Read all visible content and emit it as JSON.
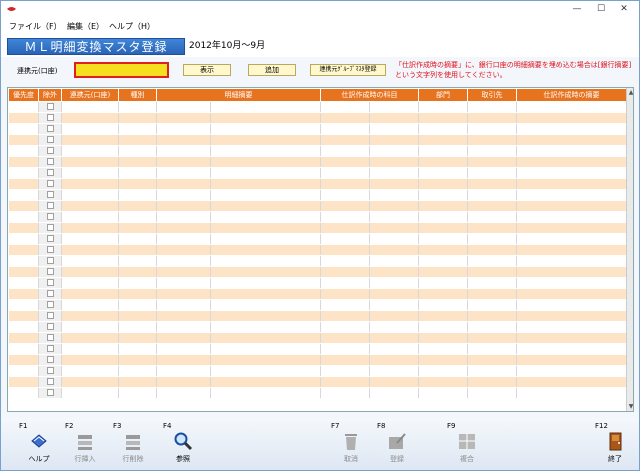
{
  "window": {
    "controls": {
      "minimize": "—",
      "maximize": "☐",
      "close": "✕"
    }
  },
  "menu": {
    "file": "ファイル（F）",
    "edit": "編集（E）",
    "help": "ヘルプ（H）"
  },
  "header": {
    "title": "ＭＬ明細変換マスタ登録",
    "period": "2012年10月～9月"
  },
  "controls": {
    "account_label": "連携元(口座)",
    "account_value": "",
    "show_button": "表示",
    "add_button": "追加",
    "group_button": "連携元ｸﾞﾙｰﾌﾟﾏｽﾀ登録",
    "notice": "「仕訳作成時の摘要」に、銀行口座の明細摘要を埋め込む場合は[銀行摘要]という文字列を使用してください。"
  },
  "grid": {
    "columns": [
      "優先度",
      "除外",
      "連携元(口座)",
      "種別",
      "明細摘要",
      "仕訳作成時の科目",
      "部門",
      "取引先",
      "仕訳作成時の摘要"
    ],
    "row_count": 27
  },
  "fkeys": [
    {
      "key": "F1",
      "label": "ヘルプ",
      "icon": "help-book-icon",
      "enabled": true
    },
    {
      "key": "F2",
      "label": "行挿入",
      "icon": "insert-row-icon",
      "enabled": false
    },
    {
      "key": "F3",
      "label": "行削除",
      "icon": "delete-row-icon",
      "enabled": false
    },
    {
      "key": "F4",
      "label": "参照",
      "icon": "magnifier-icon",
      "enabled": true
    },
    {
      "key": "F7",
      "label": "取消",
      "icon": "trash-icon",
      "enabled": false
    },
    {
      "key": "F8",
      "label": "登録",
      "icon": "register-icon",
      "enabled": false
    },
    {
      "key": "F9",
      "label": "複合",
      "icon": "compound-icon",
      "enabled": false
    },
    {
      "key": "F12",
      "label": "終了",
      "icon": "exit-door-icon",
      "enabled": true
    }
  ],
  "colors": {
    "title_bg": "#2a64b8",
    "header_bg": "#e8731f",
    "row_alt": "#fde4c6",
    "notice": "#e0101a",
    "input_bg": "#f5e020"
  }
}
